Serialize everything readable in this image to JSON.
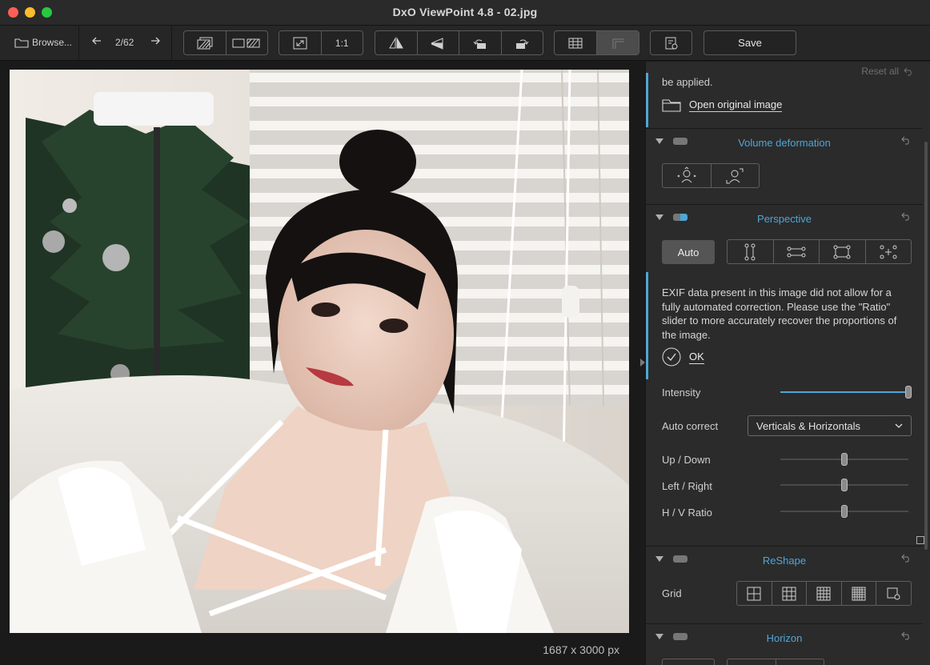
{
  "window": {
    "title": "DxO ViewPoint 4.8 - 02.jpg"
  },
  "toolbar": {
    "browse_label": "Browse...",
    "counter": "2/62",
    "zoom_100": "1:1",
    "save_label": "Save"
  },
  "viewer": {
    "image_dims": "1687 x 3000 px"
  },
  "panel": {
    "reset_all": "Reset all",
    "cut_text": "be applied.",
    "open_original": "Open original image",
    "sections": {
      "volume": "Volume deformation",
      "perspective": "Perspective",
      "reshape": "ReShape",
      "horizon": "Horizon"
    },
    "auto_label": "Auto",
    "message": "EXIF data present in this image did not allow for a fully automated correction. Please use the \"Ratio\" slider to more accurately recover the proportions of the image.",
    "ok_label": "OK",
    "intensity_label": "Intensity",
    "intensity_value": 100,
    "auto_correct_label": "Auto correct",
    "auto_correct_value": "Verticals & Horizontals",
    "up_down_label": "Up / Down",
    "up_down_value": 0.5,
    "left_right_label": "Left / Right",
    "left_right_value": 0.5,
    "hv_ratio_label": "H / V Ratio",
    "hv_ratio_value": 0.5,
    "grid_label": "Grid"
  },
  "colors": {
    "accent": "#4fa6d6",
    "panel_bg": "#2b2b2b"
  }
}
